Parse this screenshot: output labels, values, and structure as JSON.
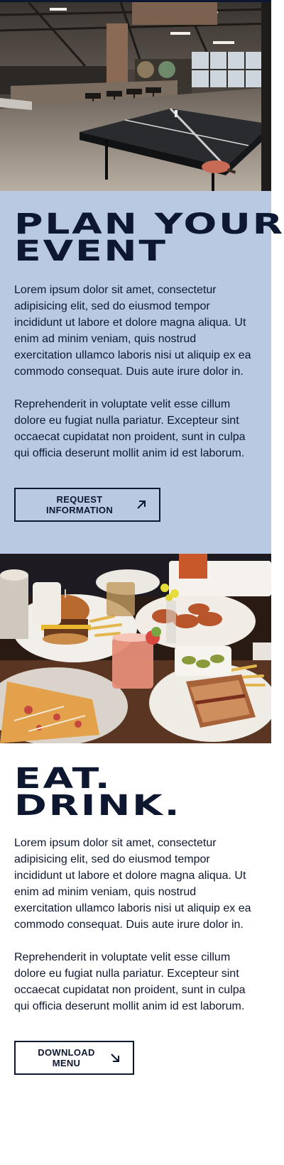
{
  "images": {
    "hero": {
      "alt": "Bar interior with ping pong table",
      "icon": "photo-bar-interior"
    },
    "food": {
      "alt": "Table spread of burgers, fries, drinks and sandwiches",
      "icon": "photo-food-spread"
    }
  },
  "plan": {
    "heading_line1": "PLAN YOUR",
    "heading_line2": "EVENT",
    "paragraph1": "Lorem ipsum dolor sit amet, consectetur adipisicing elit, sed do eiusmod tempor incididunt ut labore et dolore magna aliqua. Ut enim ad minim veniam, quis nostrud exercitation ullamco laboris nisi ut aliquip ex ea commodo consequat. Duis aute irure dolor in.",
    "paragraph2": "Reprehenderit in voluptate velit esse cillum dolore eu fugiat nulla pariatur. Excepteur sint occaecat cupidatat non proident, sunt in culpa qui officia deserunt mollit anim id est laborum.",
    "button_label": "REQUEST INFORMATION",
    "button_icon": "arrow-up-right-icon"
  },
  "eat": {
    "heading_line1": "EAT.",
    "heading_line2": "DRINK.",
    "paragraph1": "Lorem ipsum dolor sit amet, consectetur adipisicing elit, sed do eiusmod tempor incididunt ut labore et dolore magna aliqua. Ut enim ad minim veniam, quis nostrud exercitation ullamco laboris nisi ut aliquip ex ea commodo consequat. Duis aute irure dolor in.",
    "paragraph2": "Reprehenderit in voluptate velit esse cillum dolore eu fugiat nulla pariatur. Excepteur sint occaecat cupidatat non proident, sunt in culpa qui officia deserunt mollit anim id est laborum.",
    "button_label": "DOWNLOAD MENU",
    "button_icon": "arrow-down-right-icon"
  },
  "colors": {
    "navy": "#0d1830",
    "plan_background": "#b9c9e2",
    "page_background": "#ffffff"
  }
}
